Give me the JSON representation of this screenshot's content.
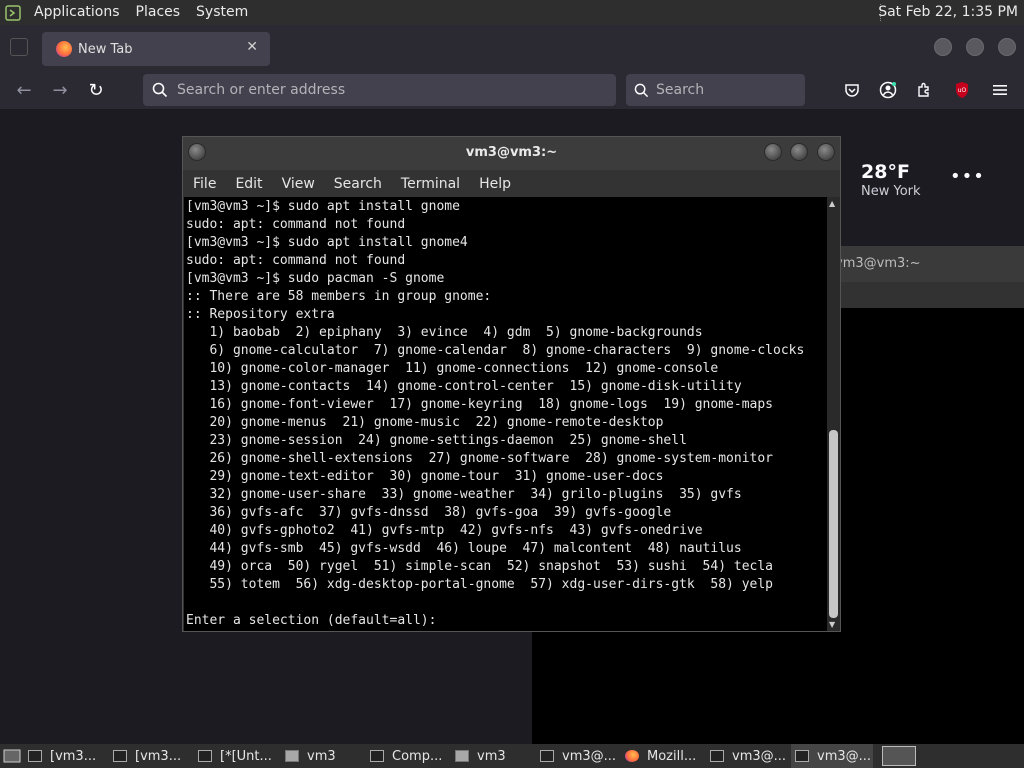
{
  "top_panel": {
    "menus": [
      "Applications",
      "Places",
      "System"
    ],
    "clock": "Sat Feb 22, 1:35 PM"
  },
  "firefox": {
    "tab": {
      "title": "New Tab",
      "close": "✕"
    },
    "url_placeholder": "Search or enter address",
    "search_placeholder": "Search",
    "weather": {
      "temp": "28°F",
      "city": "New York",
      "more": "•••"
    }
  },
  "bg_terminal": {
    "title": "vm3@vm3:~"
  },
  "terminal": {
    "title": "vm3@vm3:~",
    "menu": [
      "File",
      "Edit",
      "View",
      "Search",
      "Terminal",
      "Help"
    ],
    "lines": [
      "[vm3@vm3 ~]$ sudo apt install gnome",
      "sudo: apt: command not found",
      "[vm3@vm3 ~]$ sudo apt install gnome4",
      "sudo: apt: command not found",
      "[vm3@vm3 ~]$ sudo pacman -S gnome",
      ":: There are 58 members in group gnome:",
      ":: Repository extra",
      "   1) baobab  2) epiphany  3) evince  4) gdm  5) gnome-backgrounds",
      "   6) gnome-calculator  7) gnome-calendar  8) gnome-characters  9) gnome-clocks",
      "   10) gnome-color-manager  11) gnome-connections  12) gnome-console",
      "   13) gnome-contacts  14) gnome-control-center  15) gnome-disk-utility",
      "   16) gnome-font-viewer  17) gnome-keyring  18) gnome-logs  19) gnome-maps",
      "   20) gnome-menus  21) gnome-music  22) gnome-remote-desktop",
      "   23) gnome-session  24) gnome-settings-daemon  25) gnome-shell",
      "   26) gnome-shell-extensions  27) gnome-software  28) gnome-system-monitor",
      "   29) gnome-text-editor  30) gnome-tour  31) gnome-user-docs",
      "   32) gnome-user-share  33) gnome-weather  34) grilo-plugins  35) gvfs",
      "   36) gvfs-afc  37) gvfs-dnssd  38) gvfs-goa  39) gvfs-google",
      "   40) gvfs-gphoto2  41) gvfs-mtp  42) gvfs-nfs  43) gvfs-onedrive",
      "   44) gvfs-smb  45) gvfs-wsdd  46) loupe  47) malcontent  48) nautilus",
      "   49) orca  50) rygel  51) simple-scan  52) snapshot  53) sushi  54) tecla",
      "   55) totem  56) xdg-desktop-portal-gnome  57) xdg-user-dirs-gtk  58) yelp",
      "",
      "Enter a selection (default=all):"
    ]
  },
  "taskbar": {
    "items": [
      {
        "label": "[vm3...",
        "icon": "terminal-icon"
      },
      {
        "label": "[vm3...",
        "icon": "terminal-icon"
      },
      {
        "label": "[*[Unt...",
        "icon": "text-editor-icon"
      },
      {
        "label": "vm3",
        "icon": "folder-icon"
      },
      {
        "label": "Comp...",
        "icon": "computer-icon"
      },
      {
        "label": "vm3",
        "icon": "folder-icon"
      },
      {
        "label": "vm3@...",
        "icon": "terminal-icon"
      },
      {
        "label": "Mozill...",
        "icon": "firefox-icon"
      },
      {
        "label": "vm3@...",
        "icon": "terminal-icon"
      },
      {
        "label": "vm3@...",
        "icon": "terminal-icon"
      }
    ]
  }
}
